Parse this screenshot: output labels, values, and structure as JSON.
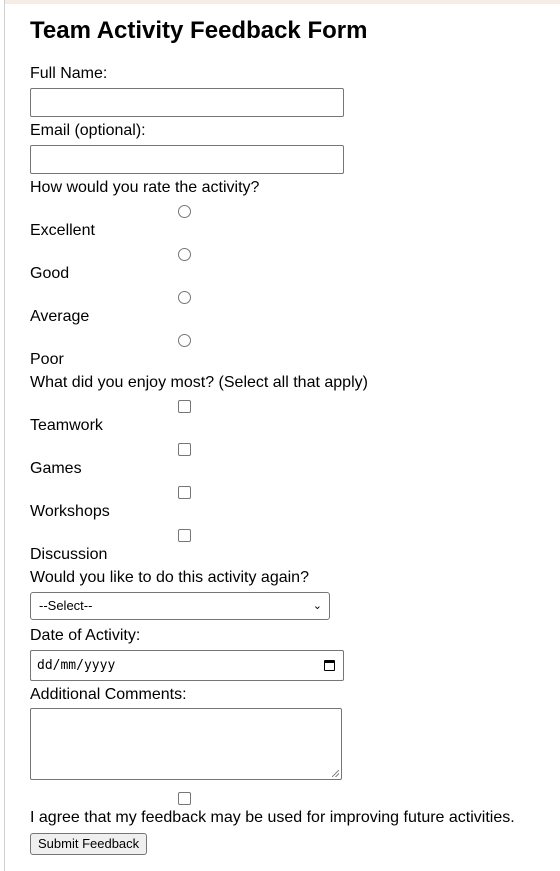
{
  "form": {
    "title": "Team Activity Feedback Form",
    "name_label": "Full Name:",
    "name_value": "",
    "email_label": "Email (optional):",
    "email_value": "",
    "rating_question": "How would you rate the activity?",
    "rating_options": [
      "Excellent",
      "Good",
      "Average",
      "Poor"
    ],
    "enjoy_question": "What did you enjoy most? (Select all that apply)",
    "enjoy_options": [
      "Teamwork",
      "Games",
      "Workshops",
      "Discussion"
    ],
    "again_question": "Would you like to do this activity again?",
    "again_selected": "--Select--",
    "date_label": "Date of Activity:",
    "date_placeholder": "dd/mm/yyyy",
    "comments_label": "Additional Comments:",
    "comments_value": "",
    "agree_label": "I agree that my feedback may be used for improving future activities.",
    "submit_label": "Submit Feedback"
  }
}
